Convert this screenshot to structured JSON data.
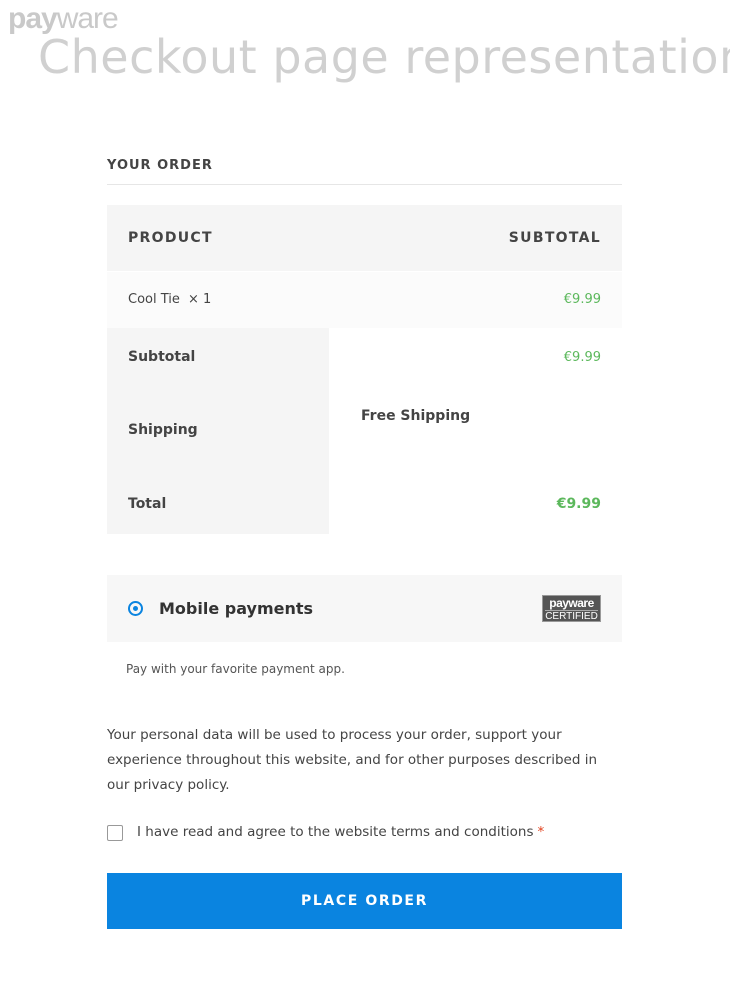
{
  "header": {
    "brand_part1": "pay",
    "brand_part2": "ware",
    "title": "Checkout page representation"
  },
  "order": {
    "heading": "YOUR ORDER",
    "columns": {
      "product": "PRODUCT",
      "subtotal": "SUBTOTAL"
    },
    "item": {
      "name": "Cool Tie",
      "qty": "× 1",
      "price": "€9.99"
    },
    "subtotal": {
      "label": "Subtotal",
      "value": "€9.99"
    },
    "shipping": {
      "label": "Shipping",
      "value": "Free Shipping"
    },
    "total": {
      "label": "Total",
      "value": "€9.99"
    }
  },
  "payment": {
    "method_label": "Mobile payments",
    "badge_line1": "payware",
    "badge_line2": "CERTIFIED",
    "description": "Pay with your favorite payment app.",
    "selected": true
  },
  "privacy_text": "Your personal data will be used to process your order, support your experience throughout this website, and for other purposes described in our privacy policy.",
  "terms": {
    "label": "I have read and agree to the website terms and conditions",
    "required_mark": "*",
    "checked": false
  },
  "place_order_label": "PLACE ORDER",
  "colors": {
    "accent": "#0a84e0",
    "price_green": "#5cb85c",
    "required_red": "#e2401c"
  }
}
